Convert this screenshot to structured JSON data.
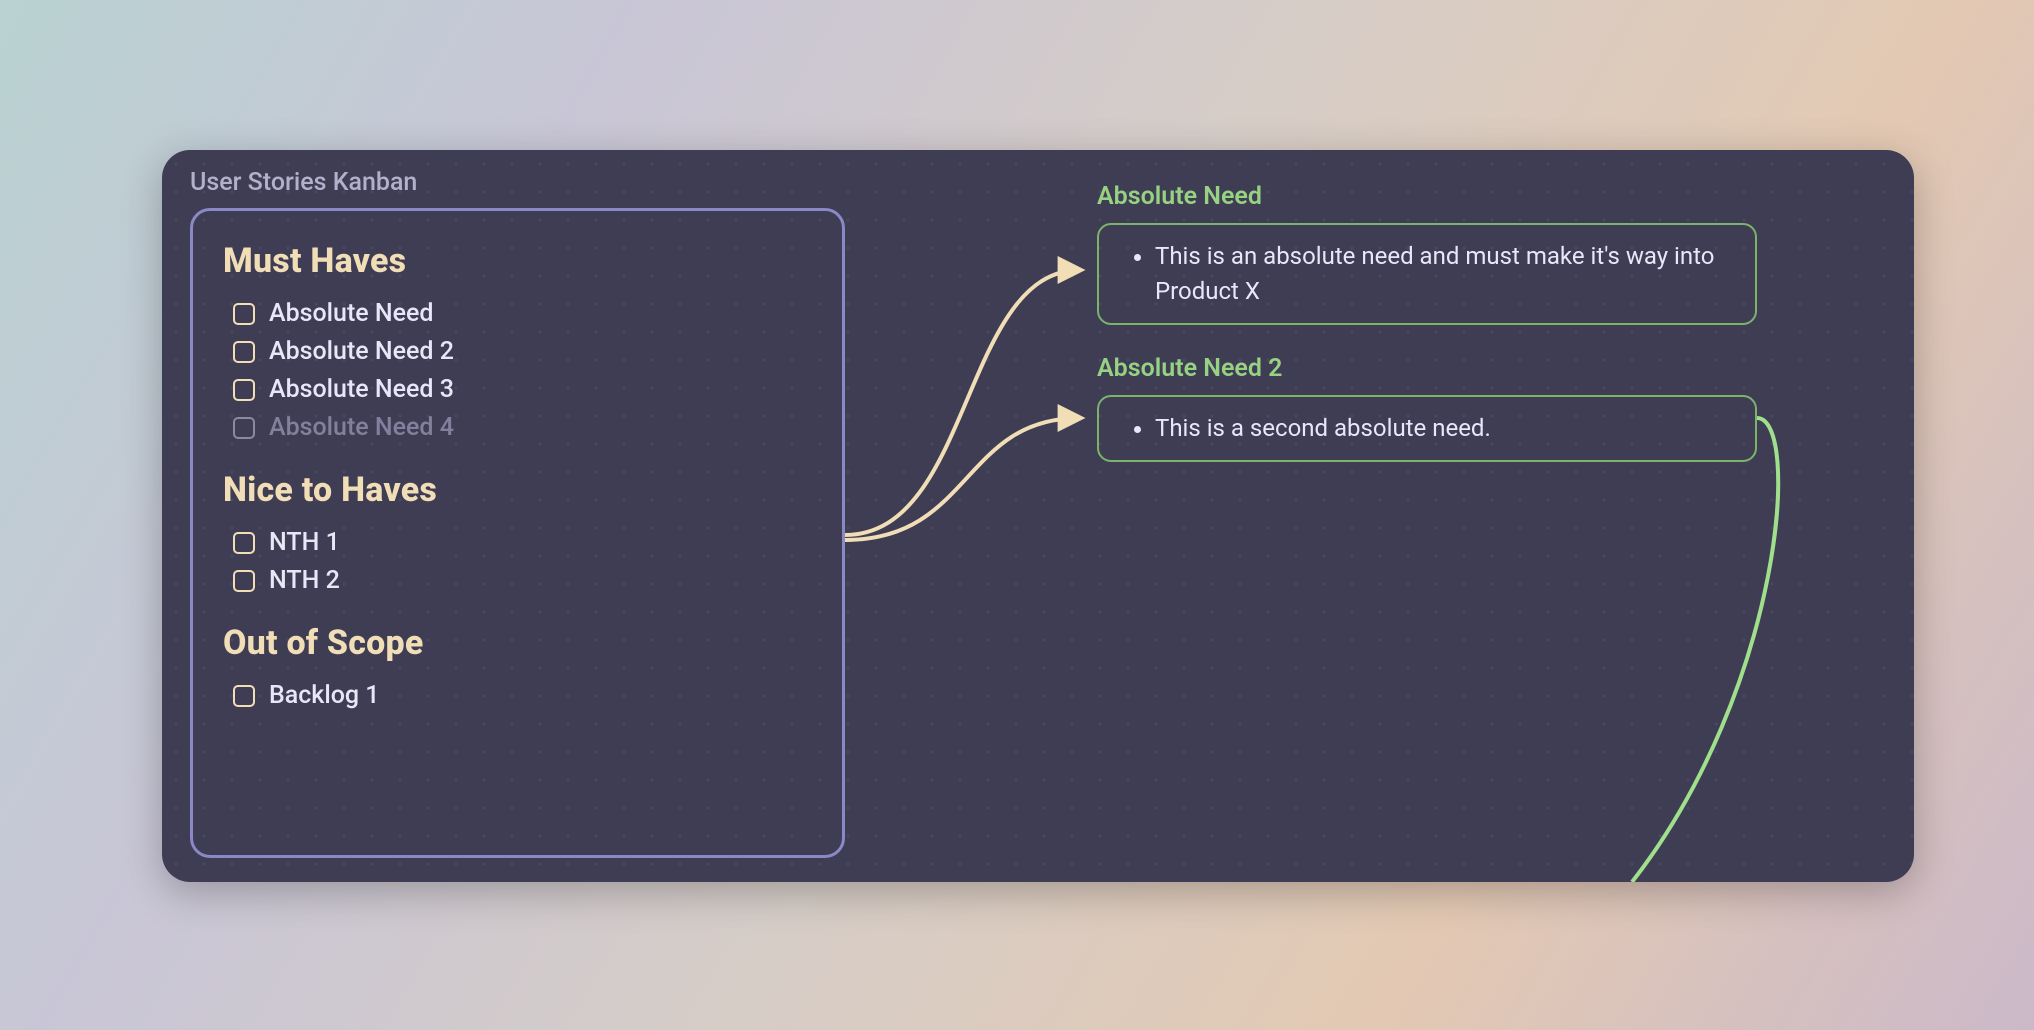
{
  "board": {
    "title": "User Stories Kanban"
  },
  "kanban": {
    "sections": [
      {
        "heading": "Must Haves",
        "items": [
          {
            "label": "Absolute Need",
            "dim": false
          },
          {
            "label": "Absolute Need 2",
            "dim": false
          },
          {
            "label": "Absolute Need 3",
            "dim": false
          },
          {
            "label": "Absolute Need 4",
            "dim": true
          }
        ]
      },
      {
        "heading": "Nice to Haves",
        "items": [
          {
            "label": "NTH 1",
            "dim": false
          },
          {
            "label": "NTH 2",
            "dim": false
          }
        ]
      },
      {
        "heading": "Out of Scope",
        "items": [
          {
            "label": "Backlog 1",
            "dim": false
          }
        ]
      }
    ]
  },
  "details": [
    {
      "title": "Absolute Need",
      "body": "This is an absolute need and must make it's way into Product X"
    },
    {
      "title": "Absolute Need 2",
      "body": "This is a second absolute need."
    }
  ],
  "colors": {
    "board_bg": "#3e3d54",
    "card_border": "#8b88c7",
    "heading": "#f1deb7",
    "text": "#e9e6f7",
    "dim_text": "#8a88a4",
    "detail_accent": "#97d182",
    "detail_border": "#7ab46a",
    "connector_tan": "#f1deb7",
    "connector_green": "#a0e08c"
  }
}
